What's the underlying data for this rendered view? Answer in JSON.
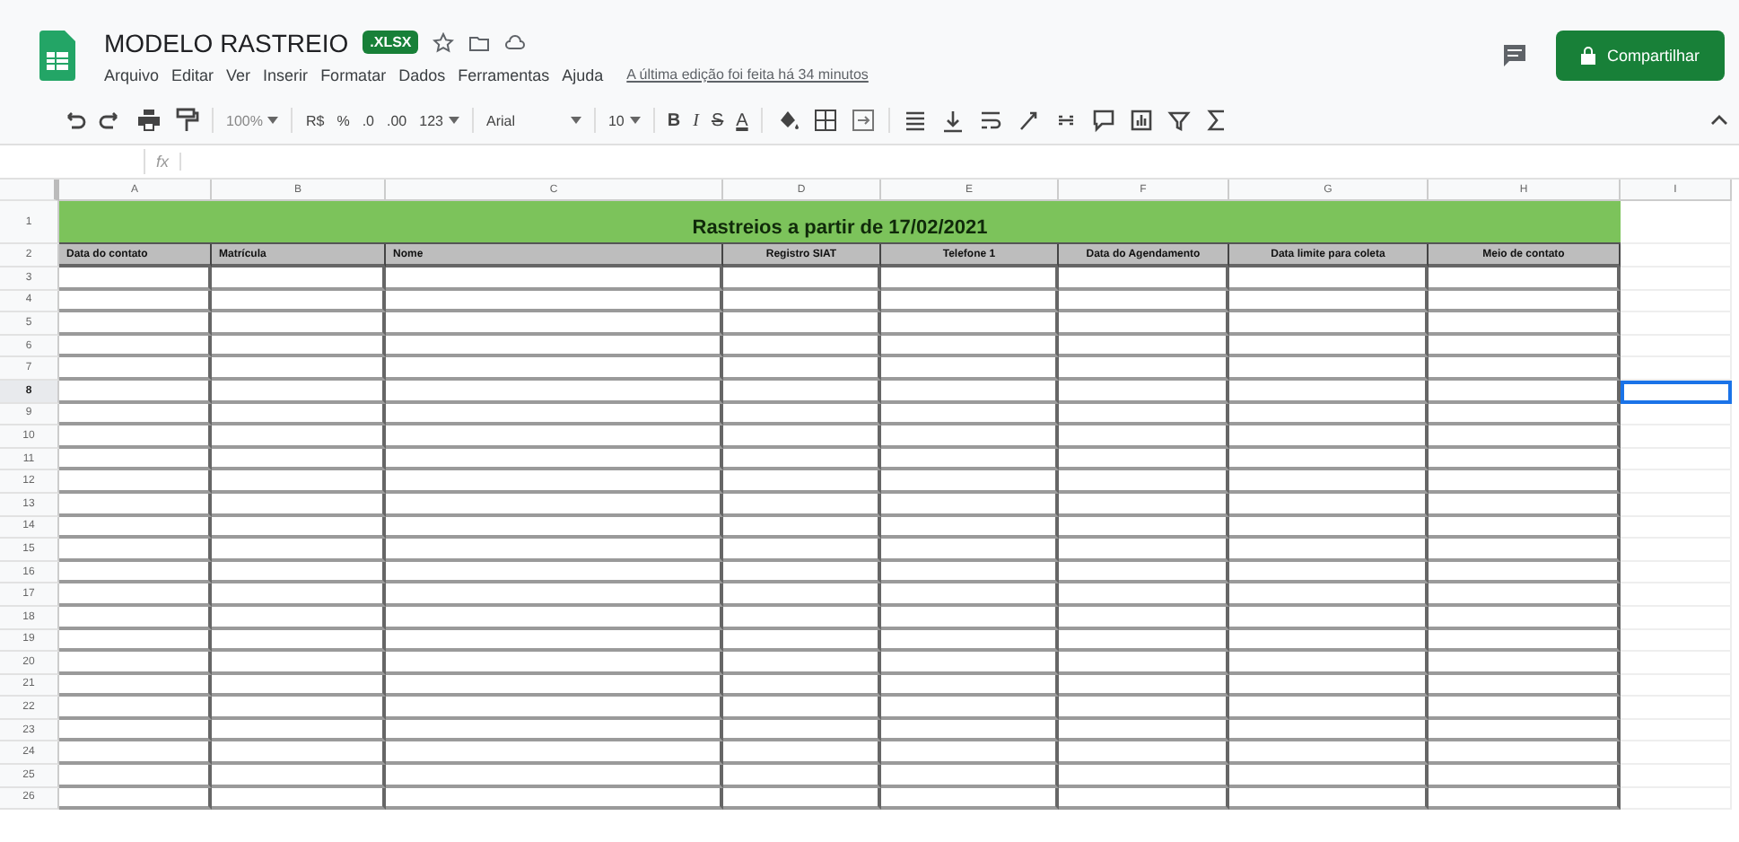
{
  "document": {
    "title": "MODELO RASTREIO",
    "badge": ".XLSX"
  },
  "menu": [
    "Arquivo",
    "Editar",
    "Ver",
    "Inserir",
    "Formatar",
    "Dados",
    "Ferramentas",
    "Ajuda"
  ],
  "last_edit": "A última edição foi feita há 34 minutos",
  "share_button": "Compartilhar",
  "toolbar": {
    "zoom": "100%",
    "currency": "R$",
    "percent": "%",
    "decimals_less": ".0",
    "decimals_more": ".00",
    "number_format": "123",
    "font": "Arial",
    "font_size": "10",
    "bold": "B",
    "italic": "I",
    "strike": "S",
    "text_color": "A"
  },
  "formula_bar": {
    "label": "fx"
  },
  "sheet": {
    "columns": [
      "A",
      "B",
      "C",
      "D",
      "E",
      "F",
      "G",
      "H",
      "I"
    ],
    "title_row": {
      "number": "1",
      "text": "Rastreios a partir de 17/02/2021"
    },
    "header_row": {
      "number": "2",
      "headers": [
        "Data do contato",
        "Matrícula",
        "Nome",
        "Registro SIAT",
        "Telefone 1",
        "Data do Agendamento",
        "Data limite para coleta",
        "Meio de contato"
      ]
    },
    "rows": [
      {
        "number": "3",
        "selected": false
      },
      {
        "number": "4",
        "selected": false
      },
      {
        "number": "5",
        "selected": false
      },
      {
        "number": "6",
        "selected": false
      },
      {
        "number": "7",
        "selected": false
      },
      {
        "number": "8",
        "selected": true
      },
      {
        "number": "9",
        "selected": false
      },
      {
        "number": "10",
        "selected": false
      },
      {
        "number": "11",
        "selected": false
      },
      {
        "number": "12",
        "selected": false
      },
      {
        "number": "13",
        "selected": false
      },
      {
        "number": "14",
        "selected": false
      },
      {
        "number": "15",
        "selected": false
      },
      {
        "number": "16",
        "selected": false
      },
      {
        "number": "17",
        "selected": false
      },
      {
        "number": "18",
        "selected": false
      },
      {
        "number": "19",
        "selected": false
      },
      {
        "number": "20",
        "selected": false
      },
      {
        "number": "21",
        "selected": false
      },
      {
        "number": "22",
        "selected": false
      },
      {
        "number": "23",
        "selected": false
      },
      {
        "number": "24",
        "selected": false
      },
      {
        "number": "25",
        "selected": false
      },
      {
        "number": "26",
        "selected": false
      }
    ]
  }
}
